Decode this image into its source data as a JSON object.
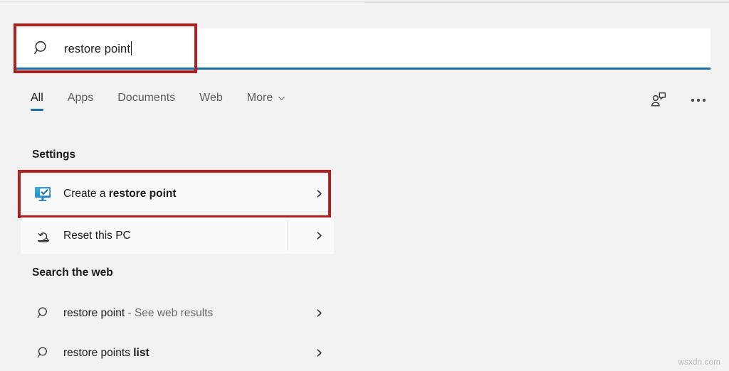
{
  "search": {
    "value": "restore point",
    "icon": "search-icon",
    "has_caret": true,
    "accent_color": "#1a6ea8",
    "highlight_color": "#b2201f"
  },
  "tabs": {
    "items": [
      {
        "label": "All",
        "active": true
      },
      {
        "label": "Apps",
        "active": false
      },
      {
        "label": "Documents",
        "active": false
      },
      {
        "label": "Web",
        "active": false
      },
      {
        "label": "More",
        "active": false,
        "icon": "chevron-down-icon"
      }
    ]
  },
  "toolbar": {
    "feedback_icon": "feedback-person-icon",
    "more_icon": "ellipsis-icon"
  },
  "sections": {
    "settings": {
      "header": "Settings",
      "results": [
        {
          "icon": "monitor-check-icon",
          "text_plain": "Create a ",
          "text_bold": "restore point",
          "chevron": "chevron-right-icon",
          "highlighted": true
        },
        {
          "icon": "reset-pc-icon",
          "text_plain": "Reset this PC",
          "text_bold": "",
          "chevron": "chevron-right-icon",
          "highlighted": false
        }
      ]
    },
    "web": {
      "header": "Search the web",
      "results": [
        {
          "icon": "search-icon",
          "text_plain": "restore point",
          "text_bold": "",
          "suffix": " - See web results",
          "chevron": "chevron-right-icon"
        },
        {
          "icon": "search-icon",
          "text_plain": "restore points ",
          "text_bold": "list",
          "suffix": "",
          "chevron": "chevron-right-icon"
        }
      ]
    }
  },
  "watermark": "wsxdn.com"
}
